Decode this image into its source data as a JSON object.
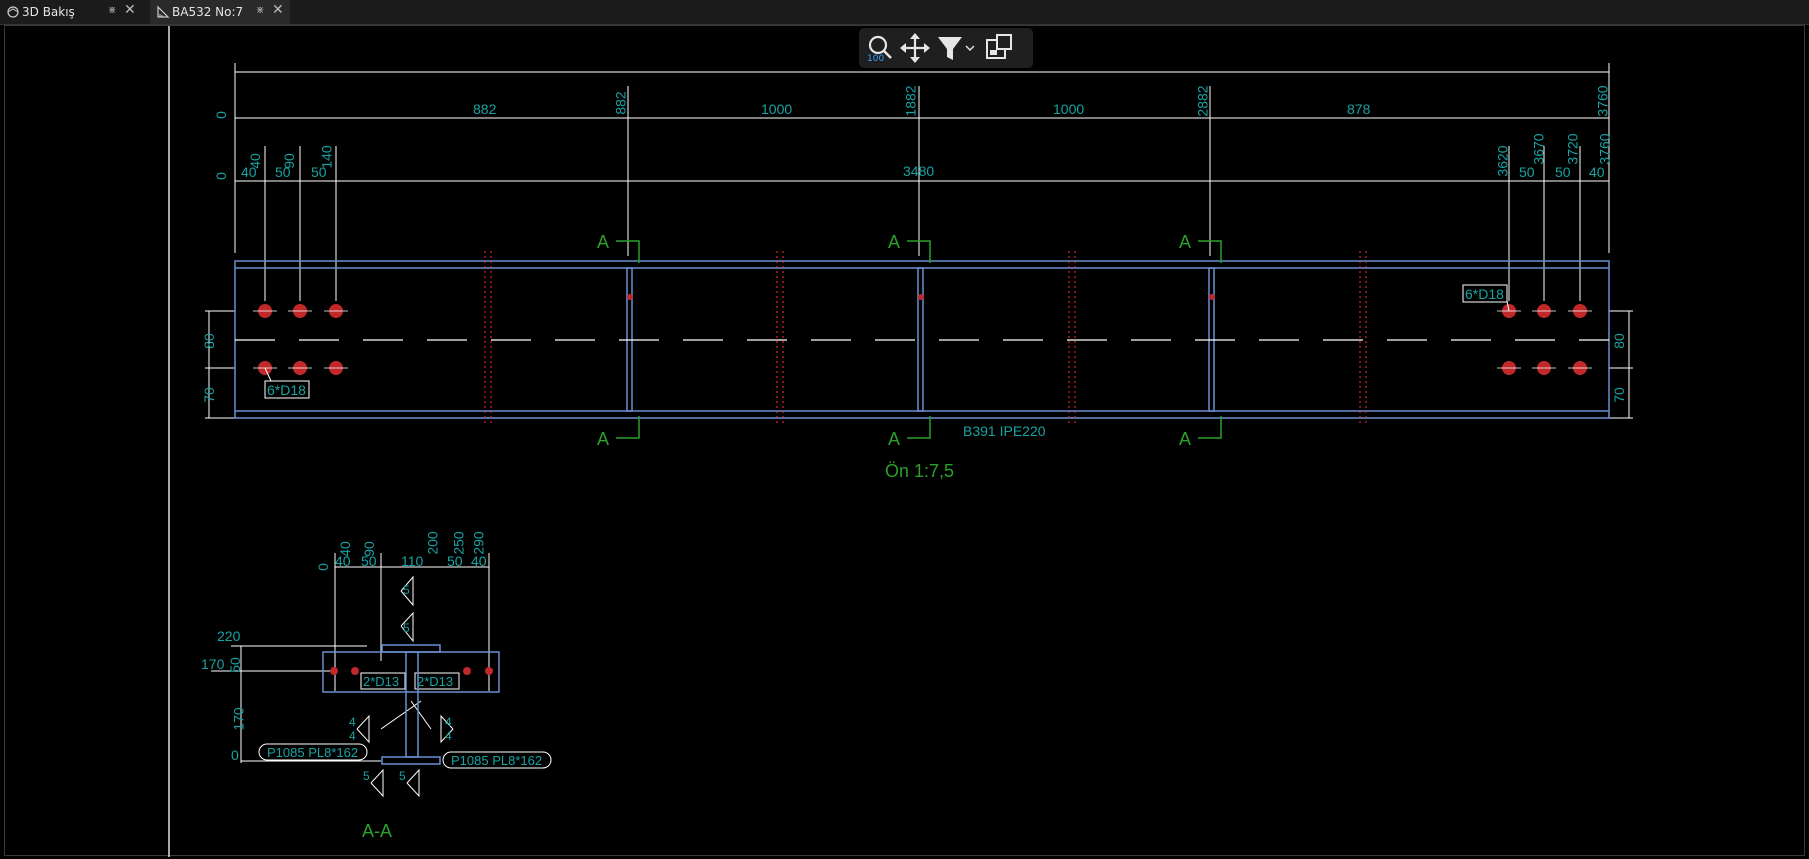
{
  "tabs": [
    {
      "label": "3D Bakış"
    },
    {
      "label": "BA532 No:7"
    }
  ],
  "toolbar": {
    "zoom": "100"
  },
  "drawing": {
    "top_dims": [
      "0",
      "882",
      "882",
      "1000",
      "1882",
      "1000",
      "2882",
      "878",
      "3760"
    ],
    "bolt_dims_left": [
      "0",
      "40",
      "50",
      "50",
      "40",
      "90",
      "140"
    ],
    "overall": "3480",
    "bolt_dims_right": [
      "3620",
      "50",
      "3670",
      "50",
      "3720",
      "40",
      "3760"
    ],
    "side_dims": [
      "80",
      "70"
    ],
    "section_mark": "A",
    "bolt_label": "6*D18",
    "beam_label": "B391 IPE220",
    "view_title": "Ön 1:7,5",
    "section": {
      "top_dims": [
        "0",
        "40",
        "90",
        "200",
        "250",
        "290"
      ],
      "seg_dims": [
        "40",
        "50",
        "110",
        "50",
        "40"
      ],
      "left_dims": [
        "220",
        "170",
        "50",
        "170",
        "0"
      ],
      "bolt_label": "2*D13",
      "weld_sizes": [
        "5",
        "5",
        "4",
        "4",
        "4",
        "4",
        "5",
        "5"
      ],
      "plate_label": "P1085 PL8*162",
      "title": "A-A"
    }
  }
}
